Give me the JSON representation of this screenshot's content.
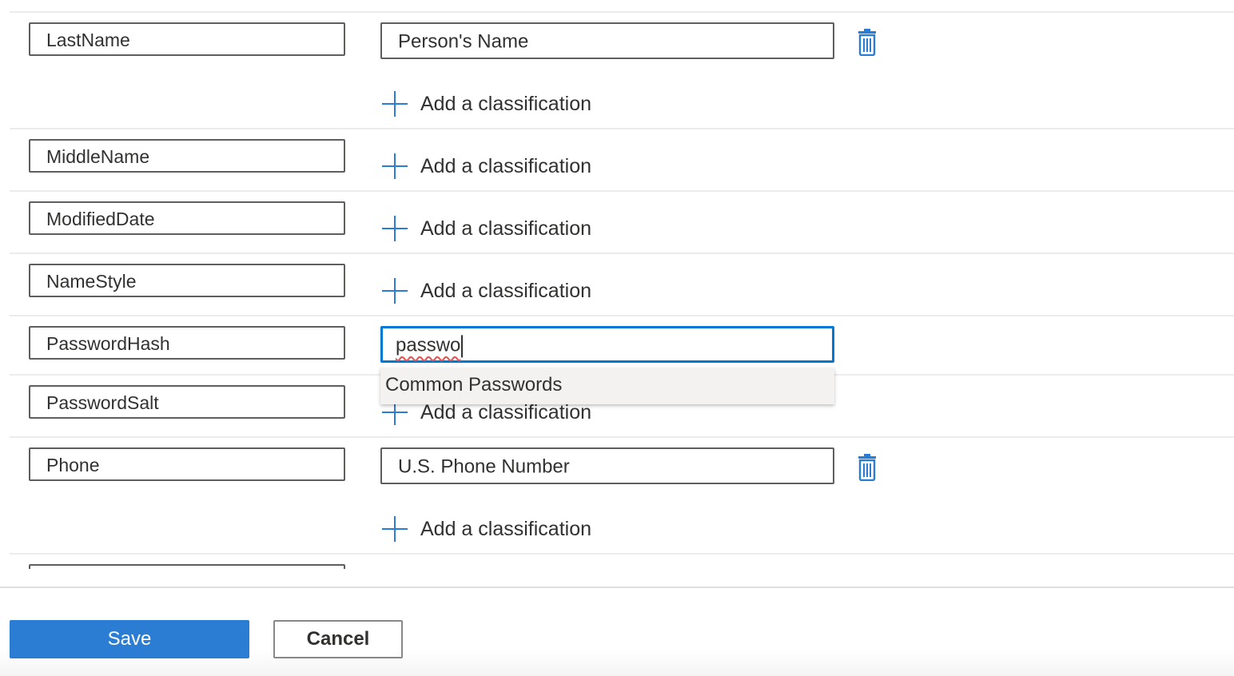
{
  "rows": [
    {
      "column": "LastName",
      "classification": "Person's Name",
      "add_label": "Add a classification"
    },
    {
      "column": "MiddleName",
      "add_label": "Add a classification"
    },
    {
      "column": "ModifiedDate",
      "add_label": "Add a classification"
    },
    {
      "column": "NameStyle",
      "add_label": "Add a classification"
    },
    {
      "column": "PasswordHash",
      "classification_input": "passwo"
    },
    {
      "column": "PasswordSalt",
      "add_label": "Add a classification"
    },
    {
      "column": "Phone",
      "classification": "U.S. Phone Number",
      "add_label": "Add a classification"
    }
  ],
  "suggestion": {
    "options": [
      "Common Passwords"
    ]
  },
  "footer": {
    "save_label": "Save",
    "cancel_label": "Cancel"
  },
  "colors": {
    "accent": "#0078d4",
    "button_primary": "#2b7cd3",
    "border": "#605e5c"
  },
  "icons": {
    "add": "plus-icon",
    "delete": "trash-icon"
  }
}
